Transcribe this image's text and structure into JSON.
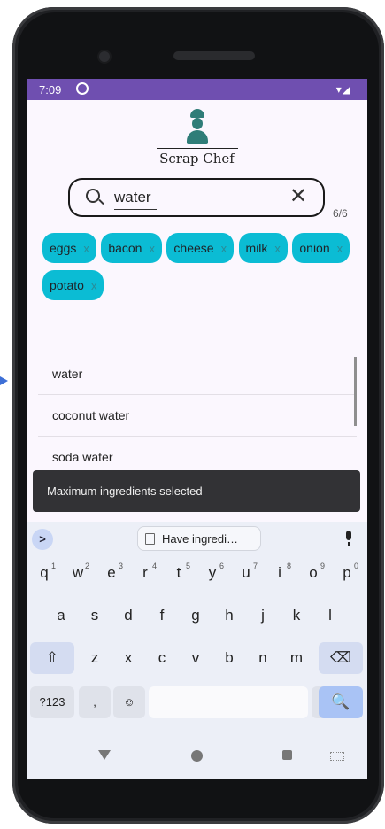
{
  "status_bar": {
    "time": "7:09",
    "icons": "▾◢"
  },
  "app": {
    "title": "Scrap Chef"
  },
  "search": {
    "value": "water",
    "clear_glyph": "✕"
  },
  "ingredient_count": "6/6",
  "chips": [
    {
      "label": "eggs",
      "remove": "x"
    },
    {
      "label": "bacon",
      "remove": "x"
    },
    {
      "label": "cheese",
      "remove": "x"
    },
    {
      "label": "milk",
      "remove": "x"
    },
    {
      "label": "onion",
      "remove": "x"
    },
    {
      "label": "potato",
      "remove": "x"
    }
  ],
  "suggestions": [
    "water",
    "coconut water",
    "soda water"
  ],
  "snackbar": {
    "message": "Maximum ingredients selected"
  },
  "keyboard": {
    "expand_glyph": ">",
    "suggestion": "Have ingredi…",
    "row1": [
      {
        "key": "q",
        "hint": "1"
      },
      {
        "key": "w",
        "hint": "2"
      },
      {
        "key": "e",
        "hint": "3"
      },
      {
        "key": "r",
        "hint": "4"
      },
      {
        "key": "t",
        "hint": "5"
      },
      {
        "key": "y",
        "hint": "6"
      },
      {
        "key": "u",
        "hint": "7"
      },
      {
        "key": "i",
        "hint": "8"
      },
      {
        "key": "o",
        "hint": "9"
      },
      {
        "key": "p",
        "hint": "0"
      }
    ],
    "row2": [
      "a",
      "s",
      "d",
      "f",
      "g",
      "h",
      "j",
      "k",
      "l"
    ],
    "row3": [
      "z",
      "x",
      "c",
      "v",
      "b",
      "n",
      "m"
    ],
    "shift_glyph": "⇧",
    "backspace_glyph": "⌫",
    "symbols_label": "?123",
    "comma": ",",
    "emoji_glyph": "☺",
    "period": ".",
    "search_glyph": "🔍"
  }
}
